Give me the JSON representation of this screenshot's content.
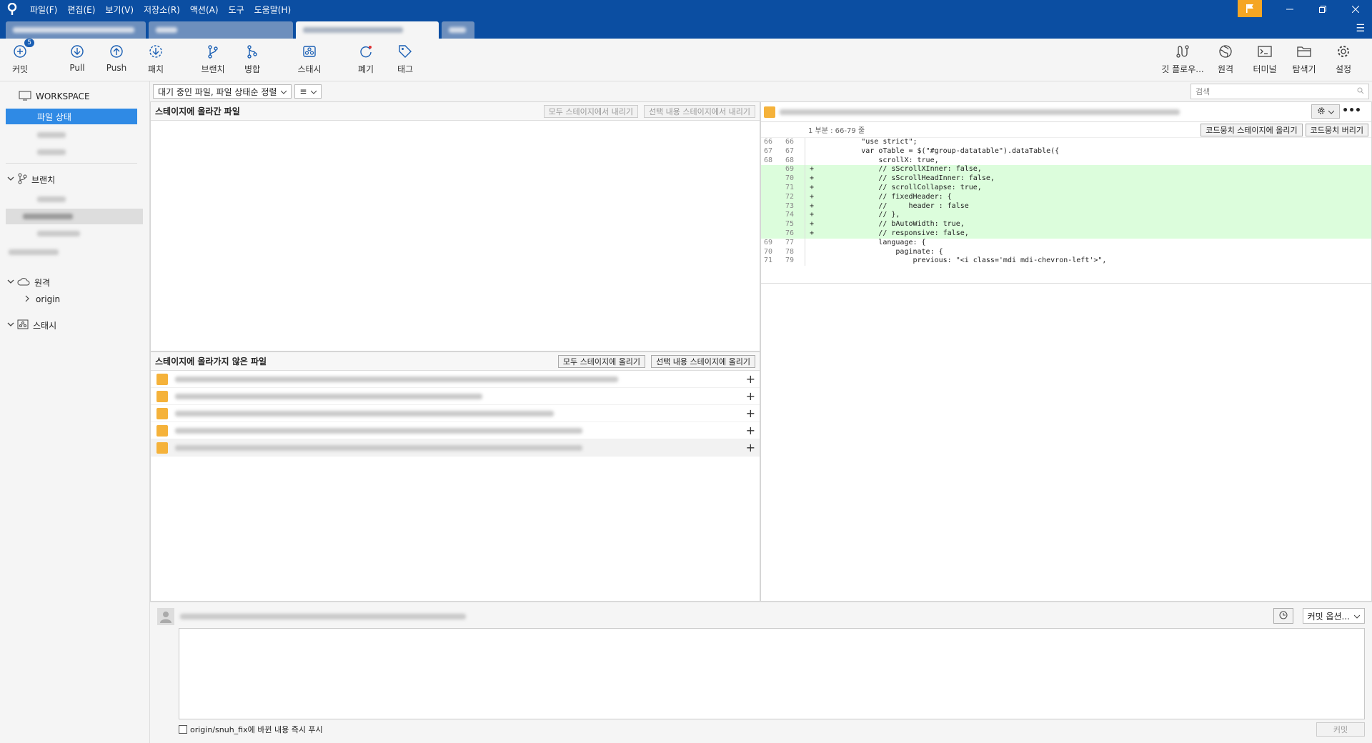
{
  "menu": [
    "파일(F)",
    "편집(E)",
    "보기(V)",
    "저장소(R)",
    "액션(A)",
    "도구",
    "도움말(H)"
  ],
  "toolbar": {
    "commit": "커밋",
    "commit_badge": "5",
    "pull": "Pull",
    "push": "Push",
    "fetch": "패치",
    "branch": "브랜치",
    "merge": "병합",
    "stash": "스태시",
    "discard": "폐기",
    "tag": "태그",
    "git_flow": "깃 플로우...",
    "remote": "원격",
    "terminal": "터미널",
    "explorer": "탐색기",
    "settings": "설정"
  },
  "sidebar": {
    "workspace": "WORKSPACE",
    "file_status": "파일 상태",
    "branches": "브랜치",
    "remotes": "원격",
    "origin": "origin",
    "stashes": "스태시"
  },
  "filter": {
    "mode": "대기 중인 파일, 파일 상태순 정렬",
    "list_icon": "≡"
  },
  "search": {
    "placeholder": "검색"
  },
  "staged": {
    "title": "스테이지에 올라간 파일",
    "unstage_all": "모두 스테이지에서 내리기",
    "unstage_selected": "선택 내용 스테이지에서 내리기"
  },
  "unstaged": {
    "title": "스테이지에 올라가지 않은 파일",
    "stage_all": "모두 스테이지에 올리기",
    "stage_selected": "선택 내용 스테이지에 올리기"
  },
  "diff": {
    "hunk_label": "1 부분 : 66-79 줄",
    "stage_hunk": "코드뭉치 스테이지에 올리기",
    "discard_hunk": "코드뭉치 버리기",
    "lines": [
      {
        "old": "66",
        "new": "66",
        "text": "            \"use strict\";",
        "add": false
      },
      {
        "old": "67",
        "new": "67",
        "text": "            var oTable = $(\"#group-datatable\").dataTable({",
        "add": false
      },
      {
        "old": "68",
        "new": "68",
        "text": "                scrollX: true,",
        "add": false
      },
      {
        "old": "",
        "new": "69",
        "text": "+               // sScrollXInner: false,",
        "add": true
      },
      {
        "old": "",
        "new": "70",
        "text": "+               // sScrollHeadInner: false,",
        "add": true
      },
      {
        "old": "",
        "new": "71",
        "text": "+               // scrollCollapse: true,",
        "add": true
      },
      {
        "old": "",
        "new": "72",
        "text": "+               // fixedHeader: {",
        "add": true
      },
      {
        "old": "",
        "new": "73",
        "text": "+               //     header : false",
        "add": true
      },
      {
        "old": "",
        "new": "74",
        "text": "+               // },",
        "add": true
      },
      {
        "old": "",
        "new": "75",
        "text": "+               // bAutoWidth: true,",
        "add": true
      },
      {
        "old": "",
        "new": "76",
        "text": "+               // responsive: false,",
        "add": true
      },
      {
        "old": "69",
        "new": "77",
        "text": "                language: {",
        "add": false
      },
      {
        "old": "70",
        "new": "78",
        "text": "                    paginate: {",
        "add": false
      },
      {
        "old": "71",
        "new": "79",
        "text": "                        previous: \"<i class='mdi mdi-chevron-left'>\",",
        "add": false
      }
    ]
  },
  "commit": {
    "options": "커밋 옵션...",
    "push_label": "origin/snuh_fix에 바뀐 내용 즉시 푸시",
    "submit": "커밋"
  }
}
